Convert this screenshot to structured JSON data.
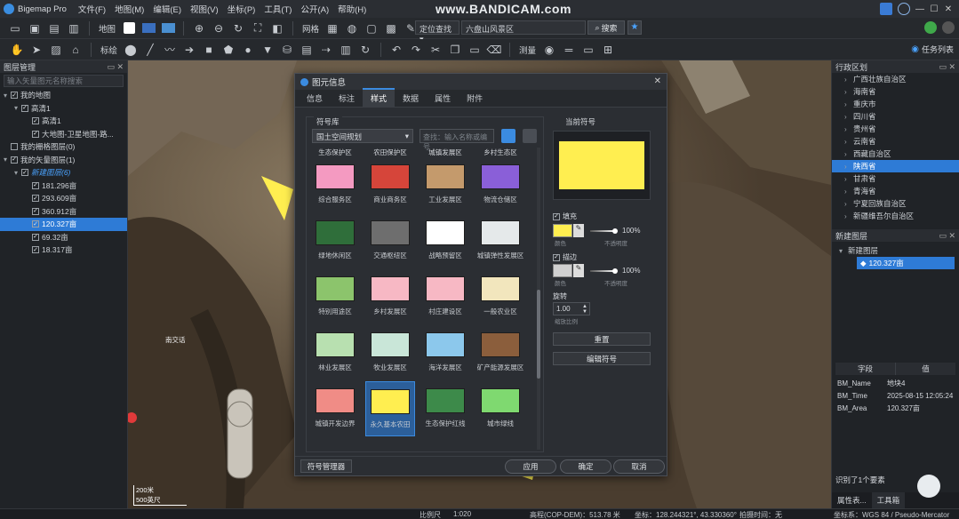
{
  "app": {
    "title": "Bigemap Pro",
    "menus": [
      "文件(F)",
      "地图(M)",
      "编辑(E)",
      "视图(V)",
      "坐标(P)",
      "工具(T)",
      "公开(A)",
      "帮助(H)"
    ],
    "watermark": "www.BANDICAM.com"
  },
  "toolbar1": {
    "map_label": "地图",
    "grid_label": "网格",
    "locate_select": "定位查找",
    "search_value": "六盘山风景区",
    "search_button": "搜索"
  },
  "toolbar2": {
    "mark_label": "标绘",
    "measure_label": "测量",
    "tasks_label": "任务列表"
  },
  "left_panel": {
    "header": "图层管理",
    "search_placeholder": "输入矢量图元名称搜索",
    "tree": [
      {
        "label": "我的地图",
        "level": 0,
        "checked": true,
        "expanded": true
      },
      {
        "label": "高清1",
        "level": 1,
        "checked": true,
        "expanded": true
      },
      {
        "label": "高清1",
        "level": 2,
        "checked": true
      },
      {
        "label": "大地图-卫星地图-路...",
        "level": 2,
        "checked": true
      },
      {
        "label": "我的栅格图层(0)",
        "level": 0,
        "checked": false
      },
      {
        "label": "我的矢量图层(1)",
        "level": 0,
        "checked": true,
        "expanded": true
      },
      {
        "label": "新建图层(6)",
        "level": 1,
        "checked": true,
        "expanded": true,
        "accent": true
      },
      {
        "label": "181.296亩",
        "level": 2,
        "checked": true
      },
      {
        "label": "293.609亩",
        "level": 2,
        "checked": true
      },
      {
        "label": "360.912亩",
        "level": 2,
        "checked": true
      },
      {
        "label": "120.327亩",
        "level": 2,
        "checked": true,
        "selected": true
      },
      {
        "label": "69.32亩",
        "level": 2,
        "checked": true
      },
      {
        "label": "18.317亩",
        "level": 2,
        "checked": true
      }
    ]
  },
  "map": {
    "place_label": "南交话",
    "scale_line1": "200米",
    "scale_line2": "500英尺"
  },
  "right_panel": {
    "admin_header": "行政区划",
    "regions": [
      "广西壮族自治区",
      "海南省",
      "重庆市",
      "四川省",
      "贵州省",
      "云南省",
      "西藏自治区",
      "陕西省",
      "甘肃省",
      "青海省",
      "宁夏回族自治区",
      "新疆维吾尔自治区"
    ],
    "selected_region": "陕西省",
    "new_header": "新建图层",
    "new_layer": "新建图层",
    "new_item": "120.327亩",
    "attr_header_field": "字段",
    "attr_header_value": "值",
    "attrs": [
      {
        "k": "BM_Name",
        "v": "地块4"
      },
      {
        "k": "BM_Time",
        "v": "2025-08-15 12:05:24"
      },
      {
        "k": "BM_Area",
        "v": "120.327亩"
      }
    ],
    "selected_count": "识别了1个要素",
    "bottom_tab1": "属性表...",
    "bottom_tab2": "工具箱"
  },
  "statusbar": {
    "scale_label": "比例尺",
    "scale_value": "1:020",
    "elevation": "高程(COP-DEM)：513.78 米",
    "coords": "坐标：128.244321°, 43.330360°",
    "shot_time": "拍摄时间：无",
    "crs": "坐标系：WGS 84 / Pseudo-Mercator"
  },
  "dialog": {
    "title": "图元信息",
    "tabs": [
      "信息",
      "标注",
      "样式",
      "数据",
      "属性",
      "附件"
    ],
    "active_tab": "样式",
    "symbol_lib_label": "符号库",
    "current_symbol_label": "当前符号",
    "library_select": "国土空间规划",
    "search_placeholder": "查找：输入名称或编号",
    "partial_labels": [
      "生态保护区",
      "农田保护区",
      "城镇发展区",
      "乡村生态区"
    ],
    "symbols": [
      {
        "label": "综合服务区",
        "color": "#f49ac1"
      },
      {
        "label": "商业商务区",
        "color": "#d6453a"
      },
      {
        "label": "工业发展区",
        "color": "#c49a6c"
      },
      {
        "label": "物流仓储区",
        "color": "#8a5fd8"
      },
      {
        "label": "绿地休闲区",
        "color": "#2f6e3a"
      },
      {
        "label": "交通枢纽区",
        "color": "#6e6e6e"
      },
      {
        "label": "战略预留区",
        "color": "#ffffff"
      },
      {
        "label": "城镇弹性发展区",
        "color": "#e5e9ea"
      },
      {
        "label": "特别用途区",
        "color": "#8cc46c"
      },
      {
        "label": "乡村发展区",
        "color": "#f7b8c4"
      },
      {
        "label": "村庄建设区",
        "color": "#f7b8c4"
      },
      {
        "label": "一般农业区",
        "color": "#f2e6bd"
      },
      {
        "label": "林业发展区",
        "color": "#b8e0b0"
      },
      {
        "label": "牧业发展区",
        "color": "#c9e6d8"
      },
      {
        "label": "海洋发展区",
        "color": "#8cc8ec"
      },
      {
        "label": "矿产能源发展区",
        "color": "#8b5e3c"
      },
      {
        "label": "城镇开发边界",
        "color": "#f08c86"
      },
      {
        "label": "永久基本农田",
        "color": "#ffee50",
        "selected": true
      },
      {
        "label": "生态保护红线",
        "color": "#3d8a4a"
      },
      {
        "label": "城市绿线",
        "color": "#7fd970"
      }
    ],
    "current_color": "#ffee50",
    "fill_label": "填充",
    "fill_color": "#ffee50",
    "fill_color_caption": "颜色",
    "fill_opacity": "100%",
    "fill_opacity_caption": "不透明度",
    "stroke_label": "描边",
    "stroke_color": "#d0d0d0",
    "stroke_color_caption": "颜色",
    "stroke_opacity": "100%",
    "stroke_opacity_caption": "不透明度",
    "rotate_label": "旋转",
    "rotate_value": "1.00",
    "rotate_caption": "缩放比例",
    "reset_button": "重置",
    "edit_button": "编辑符号",
    "manager_button": "符号管理器",
    "apply_button": "应用",
    "ok_button": "确定",
    "cancel_button": "取消"
  }
}
